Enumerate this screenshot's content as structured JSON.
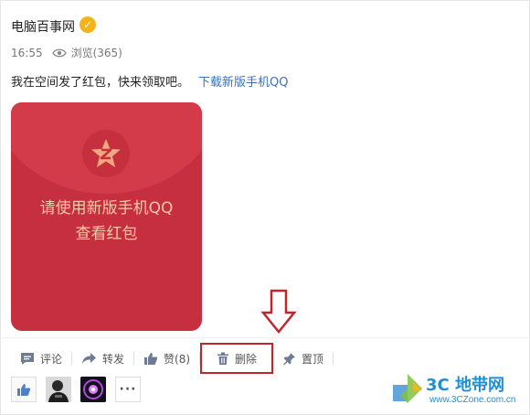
{
  "post": {
    "author": "电脑百事网",
    "time": "16:55",
    "views": "浏览(365)",
    "text": "我在空间发了红包，快来领取吧。",
    "link": "下载新版手机QQ"
  },
  "red_envelope": {
    "line1": "请使用新版手机QQ",
    "line2": "查看红包"
  },
  "actions": [
    {
      "label": "评论",
      "icon": "comment-icon"
    },
    {
      "label": "转发",
      "icon": "share-icon"
    },
    {
      "label": "赞(8)",
      "icon": "thumbs-up-icon"
    },
    {
      "label": "删除",
      "icon": "trash-icon"
    },
    {
      "label": "置顶",
      "icon": "pin-icon"
    }
  ],
  "likers": {
    "more": "···"
  },
  "watermark": {
    "brand": "3C 地带网",
    "url": "www.3CZone.com.cn"
  },
  "colors": {
    "envelope": "#c62f3f",
    "envelope_text": "#f6c9a8",
    "link": "#3d6fb6",
    "highlight": "#c0272d",
    "verified": "#f5b21a",
    "watermark": "#1f8fd6"
  }
}
